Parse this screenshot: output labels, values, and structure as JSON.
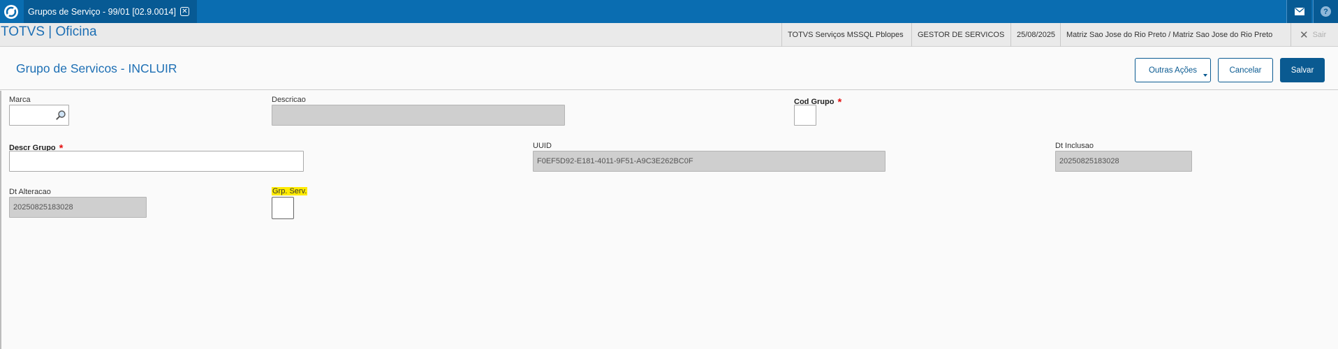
{
  "topbar": {
    "tab_title": "Grupos de Serviço - 99/01 [02.9.0014]",
    "icons": [
      "totvs-logo-icon",
      "close-icon",
      "mail-icon",
      "help-icon"
    ]
  },
  "infobar": {
    "app_title": "TOTVS | Oficina",
    "environment": "TOTVS Serviços MSSQL Pblopes",
    "user": "GESTOR DE SERVICOS",
    "date": "25/08/2025",
    "branch": "Matriz Sao Jose do Rio Preto / Matriz Sao Jose do Rio Preto",
    "exit_label": "Sair"
  },
  "header": {
    "title": "Grupo de Servicos - INCLUIR",
    "more_actions_label": "Outras Ações",
    "cancel_label": "Cancelar",
    "save_label": "Salvar"
  },
  "form": {
    "marca": {
      "label": "Marca",
      "value": ""
    },
    "descricao": {
      "label": "Descricao",
      "value": ""
    },
    "cod_grupo": {
      "label": "Cod Grupo",
      "required_mark": "*"
    },
    "descr_grupo": {
      "label": "Descr Grupo",
      "required_mark": "*",
      "value": ""
    },
    "uuid": {
      "label": "UUID",
      "value": "F0EF5D92-E181-4011-9F51-A9C3E262BC0F"
    },
    "dt_inclusao": {
      "label": "Dt Inclusao",
      "value": "20250825183028"
    },
    "dt_alteracao": {
      "label": "Dt Alteracao",
      "value": "20250825183028"
    },
    "grp_serv": {
      "label": "Grp. Serv.",
      "checked": false
    }
  },
  "colors": {
    "top_bar": "#0a6db1",
    "accent": "#0a5a91",
    "highlight": "#ffeb00",
    "required": "#e41414"
  }
}
